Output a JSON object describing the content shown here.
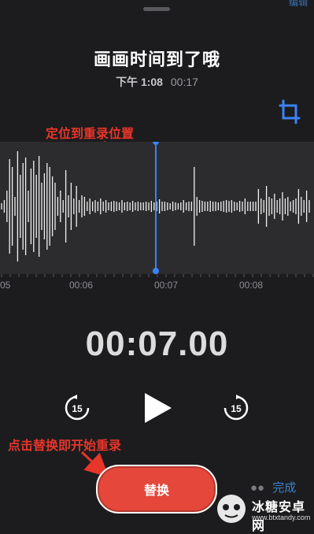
{
  "header": {
    "corner_text": "编辑",
    "title": "画画时间到了哦",
    "date_time": "下午 1:08",
    "duration": "00:17"
  },
  "annotations": {
    "top": "定位到重录位置",
    "bottom": "点击替换即开始重录"
  },
  "timeline": {
    "ticks": [
      "05",
      "00:06",
      "00:07",
      "00:08"
    ]
  },
  "playback": {
    "current_time": "00:07.00",
    "skip_back_label": "15",
    "skip_forward_label": "15"
  },
  "actions": {
    "replace_label": "替换",
    "done_label": "完成"
  },
  "watermark": {
    "brand": "冰糖安卓网",
    "url": "www.btxtandy.com"
  },
  "colors": {
    "accent": "#3b82f6",
    "record_red": "#e5473b",
    "annotation_red": "#e8352a"
  }
}
